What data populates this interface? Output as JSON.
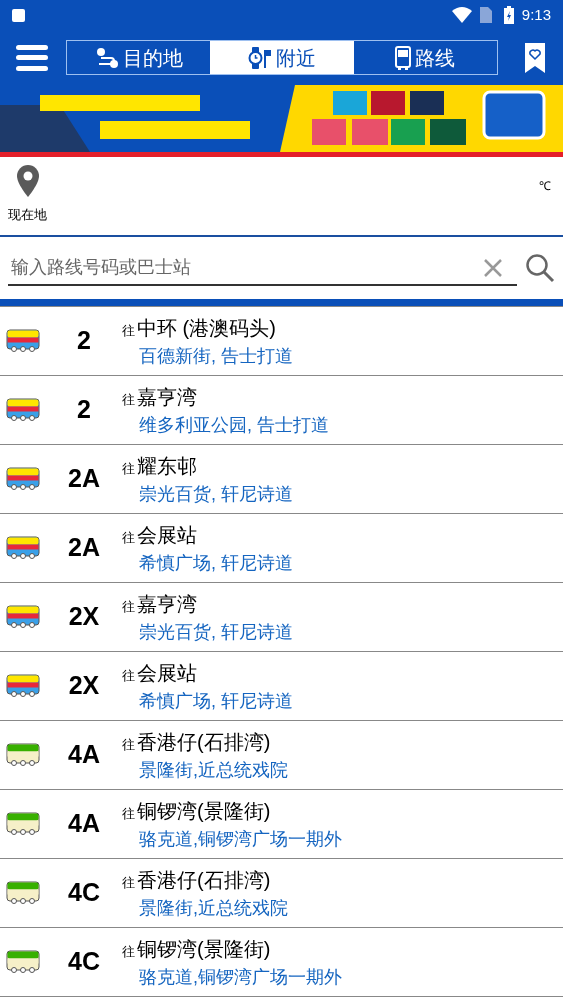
{
  "status_bar": {
    "time": "9:13"
  },
  "tabs": [
    {
      "label": "目的地",
      "kind": "route",
      "selected": false
    },
    {
      "label": "附近",
      "kind": "watch",
      "selected": true
    },
    {
      "label": "路线",
      "kind": "bus",
      "selected": false
    }
  ],
  "location": {
    "label": "现在地",
    "temperature": "℃"
  },
  "search": {
    "placeholder": "输入路线号码或巴士站"
  },
  "routes": [
    {
      "kind": "yellow",
      "route": "2",
      "to_prefix": "往",
      "destination": "中环 (港澳码头)",
      "stop": "百德新街, 告士打道"
    },
    {
      "kind": "yellow",
      "route": "2",
      "to_prefix": "往",
      "destination": "嘉亨湾",
      "stop": "维多利亚公园, 告士打道"
    },
    {
      "kind": "yellow",
      "route": "2A",
      "to_prefix": "往",
      "destination": "耀东邨",
      "stop": "崇光百货, 轩尼诗道"
    },
    {
      "kind": "yellow",
      "route": "2A",
      "to_prefix": "往",
      "destination": "会展站",
      "stop": "希慎广场, 轩尼诗道"
    },
    {
      "kind": "yellow",
      "route": "2X",
      "to_prefix": "往",
      "destination": "嘉亨湾",
      "stop": "崇光百货, 轩尼诗道"
    },
    {
      "kind": "yellow",
      "route": "2X",
      "to_prefix": "往",
      "destination": "会展站",
      "stop": "希慎广场, 轩尼诗道"
    },
    {
      "kind": "green",
      "route": "4A",
      "to_prefix": "往",
      "destination": "香港仔(石排湾)",
      "stop": "景隆街,近总统戏院"
    },
    {
      "kind": "green",
      "route": "4A",
      "to_prefix": "往",
      "destination": "铜锣湾(景隆街)",
      "stop": "骆克道,铜锣湾广场一期外"
    },
    {
      "kind": "green",
      "route": "4C",
      "to_prefix": "往",
      "destination": "香港仔(石排湾)",
      "stop": "景隆街,近总统戏院"
    },
    {
      "kind": "green",
      "route": "4C",
      "to_prefix": "往",
      "destination": "铜锣湾(景隆街)",
      "stop": "骆克道,铜锣湾广场一期外"
    }
  ]
}
